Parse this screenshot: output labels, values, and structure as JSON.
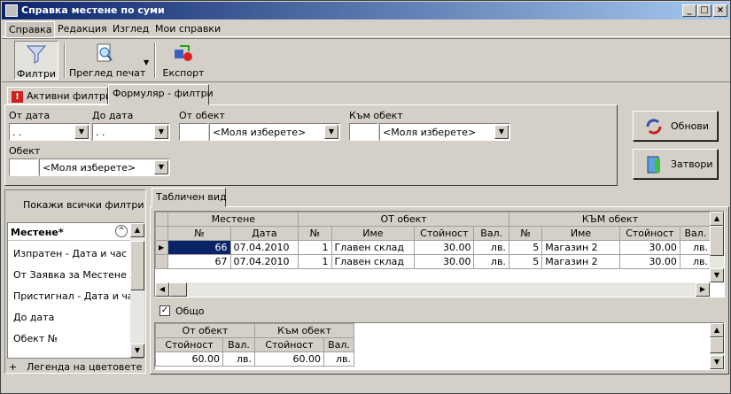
{
  "title": "Справка местене по суми",
  "window_buttons": {
    "min": "_",
    "max": "□",
    "close": "×"
  },
  "menu": [
    "Справка",
    "Редакция",
    "Изглед",
    "Мои справки"
  ],
  "toolbar": {
    "filters": "Филтри",
    "print_preview": "Преглед печат",
    "export": "Експорт"
  },
  "filter_tabs": {
    "active": "Активни филтри",
    "form": "Формуляр - филтри"
  },
  "filters": {
    "from_date": "От дата",
    "to_date": "До дата",
    "from_obj": "От обект",
    "to_obj": "Към обект",
    "obj": "Обект",
    "date_placeholder": " .  .",
    "select_placeholder": "<Моля изберете>"
  },
  "buttons": {
    "refresh": "Обнови",
    "close": "Затвори"
  },
  "left_panel": {
    "show_all": "Покажи всички филтри",
    "header": "Местене*",
    "items": [
      "Изпратен - Дата и час",
      "От Заявка за Местене №",
      "Пристигнал - Дата и час",
      "До дата",
      "Обект №"
    ],
    "legend": "Легенда на цветовете"
  },
  "view_tab": "Табличен вид",
  "table": {
    "groups": [
      "Местене",
      "ОТ обект",
      "КЪМ обект"
    ],
    "columns": [
      "№",
      "Дата",
      "№",
      "Име",
      "Стойност",
      "Вал.",
      "№",
      "Име",
      "Стойност",
      "Вал."
    ],
    "rows": [
      [
        "66",
        "07.04.2010",
        "1",
        "Главен склад",
        "30.00",
        "лв.",
        "5",
        "Магазин 2",
        "30.00",
        "лв."
      ],
      [
        "67",
        "07.04.2010",
        "1",
        "Главен склад",
        "30.00",
        "лв.",
        "5",
        "Магазин 2",
        "30.00",
        "лв."
      ]
    ]
  },
  "total": {
    "label": "Общо",
    "groups": [
      "От обект",
      "Към обект"
    ],
    "columns": [
      "Стойност",
      "Вал.",
      "Стойност",
      "Вал."
    ],
    "row": [
      "60.00",
      "лв.",
      "60.00",
      "лв."
    ]
  }
}
